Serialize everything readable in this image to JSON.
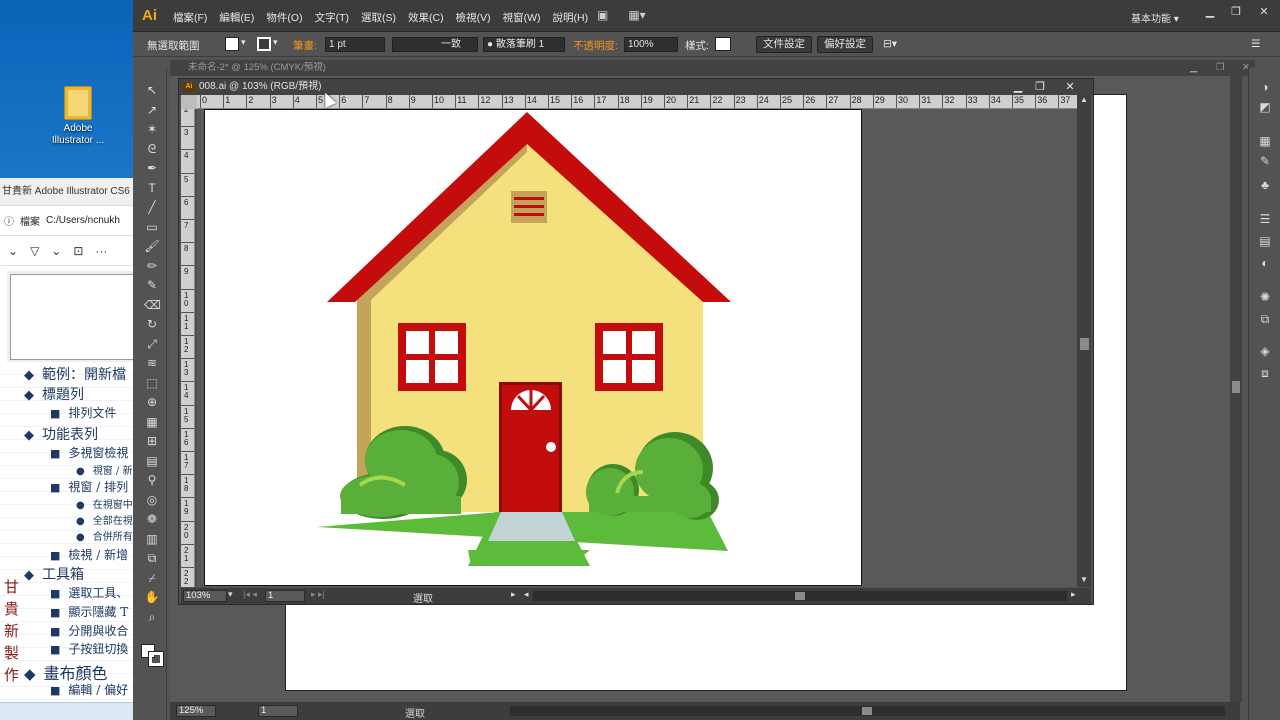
{
  "desktop": {
    "icon_label": "Adobe Illustrator ..."
  },
  "doc_window": {
    "title": "甘貴新 Adobe Illustrator CS6 專題",
    "addr_prefix": "檔案",
    "addr_path": "C:/Users/ncnukh",
    "items": [
      {
        "bullet": "◆",
        "text": "範例：開新檔"
      },
      {
        "bullet": "◆",
        "text": "標題列"
      },
      {
        "bullet": "■",
        "text": "排列文件"
      },
      {
        "bullet": "◆",
        "text": "功能表列"
      },
      {
        "bullet": "■",
        "text": "多視窗檢視"
      },
      {
        "bullet": "●",
        "text": "視窗 / 新"
      },
      {
        "bullet": "■",
        "text": "視窗 / 排列"
      },
      {
        "bullet": "●",
        "text": "在視窗中"
      },
      {
        "bullet": "●",
        "text": "全部在視"
      },
      {
        "bullet": "●",
        "text": "合併所有"
      },
      {
        "bullet": "■",
        "text": "檢視 / 新增"
      },
      {
        "bullet": "◆",
        "text": "工具箱"
      },
      {
        "bullet": "■",
        "text": "選取工具、"
      },
      {
        "bullet": "■",
        "text": "顯示隱藏 T"
      },
      {
        "bullet": "■",
        "text": "分開與收合"
      },
      {
        "bullet": "■",
        "text": "子按鈕切換"
      },
      {
        "bullet": "◆",
        "text": "畫布顏色"
      },
      {
        "bullet": "■",
        "text": "編輯 / 偏好"
      }
    ],
    "side_chars": [
      "甘",
      "貴",
      "新",
      "製",
      "作"
    ]
  },
  "menubar": {
    "logo": "Ai",
    "items": [
      "檔案(F)",
      "編輯(E)",
      "物件(O)",
      "文字(T)",
      "選取(S)",
      "效果(C)",
      "檢視(V)",
      "視窗(W)",
      "說明(H)"
    ],
    "workspace": "基本功能"
  },
  "controlbar": {
    "selection": "無選取範圍",
    "stroke_label": "筆畫:",
    "stroke_value": "1 pt",
    "profile_value": "一致",
    "brush_value": "散落筆刷 1",
    "opacity_label": "不透明度:",
    "opacity_value": "100%",
    "style_label": "樣式:",
    "doc_setup": "文件設定",
    "prefs": "偏好設定"
  },
  "bg_document": {
    "tab": "未命名-2* @ 125% (CMYK/預視)",
    "zoom": "125%",
    "page": "1",
    "status": "選取"
  },
  "fg_document": {
    "title": "008.ai @ 103% (RGB/預視)",
    "zoom": "103%",
    "page": "1",
    "status": "選取",
    "ruler_h": [
      "0",
      "1",
      "2",
      "3",
      "4",
      "5",
      "6",
      "7",
      "8",
      "9",
      "10",
      "11",
      "12",
      "13",
      "14",
      "15",
      "16",
      "17",
      "18",
      "19",
      "20",
      "21",
      "22",
      "23",
      "24",
      "25",
      "26",
      "27",
      "28",
      "29",
      "30",
      "31",
      "32",
      "33",
      "34",
      "35",
      "36",
      "37"
    ],
    "ruler_v": [
      "2",
      "3",
      "4",
      "5",
      "6",
      "7",
      "8",
      "9",
      "1 0",
      "1 1",
      "1 2",
      "1 3",
      "1 4",
      "1 5",
      "1 6",
      "1 7",
      "1 8",
      "1 9",
      "2 0",
      "2 1",
      "2 2"
    ]
  },
  "colors": {
    "roof": "#c40c0c",
    "wall": "#f4e07c",
    "wall_shadow": "#c3a45a",
    "door": "#c30d0d",
    "bush": "#5aae3a",
    "grass": "#5dbb3c",
    "path": "#c4d4d6"
  }
}
